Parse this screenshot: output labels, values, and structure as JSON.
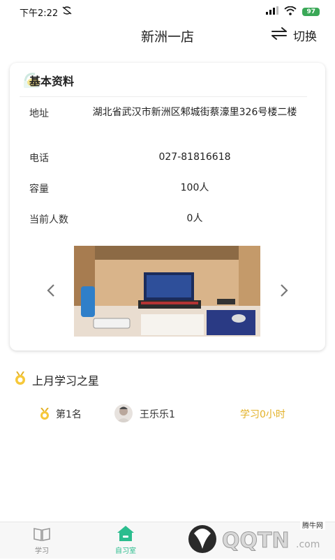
{
  "status_bar": {
    "time": "下午2:22",
    "battery": "97"
  },
  "header": {
    "title": "新洲一店",
    "switch_label": "切换"
  },
  "info_card": {
    "title": "基本资料",
    "address_label": "地址",
    "address_value": "湖北省武汉市新洲区邾城街蔡濠里326号楼二楼",
    "phone_label": "电话",
    "phone_value": "027-81816618",
    "capacity_label": "容量",
    "capacity_value": "100人",
    "current_label": "当前人数",
    "current_value": "0人"
  },
  "star_section": {
    "title": "上月学习之星",
    "rank_label": "第1名",
    "user_name": "王乐乐1",
    "study_time": "学习0小时"
  },
  "tabbar": {
    "items": [
      {
        "label": "学习"
      },
      {
        "label": "自习室"
      }
    ]
  },
  "watermark": {
    "site": "腾牛网",
    "brand": "QQTN.com"
  },
  "colors": {
    "accent": "#2bbd8e",
    "gold": "#e3b127",
    "battery": "#3aa857"
  },
  "icons": [
    "no-disturb-icon",
    "signal-icon",
    "wifi-icon",
    "battery-icon",
    "swap-icon",
    "medal-icon",
    "book-icon",
    "home-icon",
    "chevron-left-icon",
    "chevron-right-icon"
  ]
}
